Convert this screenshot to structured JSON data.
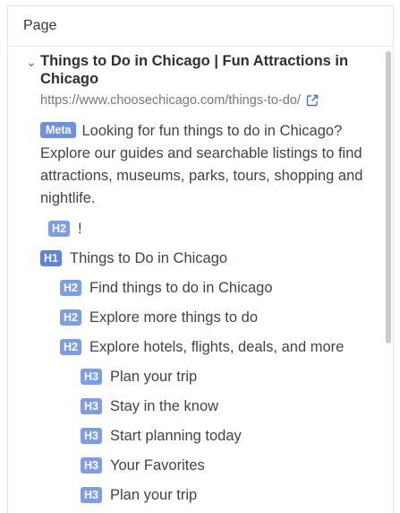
{
  "panel": {
    "header": "Page"
  },
  "page": {
    "title": "Things to Do in Chicago | Fun Attractions in Chicago",
    "url": "https://www.choosechicago.com/things-to-do/",
    "meta_badge": "Meta",
    "meta_description": "Looking for fun things to do in Chicago? Explore our guides and searchable listings to find attractions, museums, parks, tours, shopping and nightlife."
  },
  "headings": [
    {
      "level": "H2",
      "text": "!"
    },
    {
      "level": "H1",
      "text": "Things to Do in Chicago"
    },
    {
      "level": "H2",
      "text": "Find things to do in Chicago"
    },
    {
      "level": "H2",
      "text": "Explore more things to do"
    },
    {
      "level": "H2",
      "text": "Explore hotels, flights, deals, and more"
    },
    {
      "level": "H3",
      "text": "Plan your trip"
    },
    {
      "level": "H3",
      "text": "Stay in the know"
    },
    {
      "level": "H3",
      "text": "Start planning today"
    },
    {
      "level": "H3",
      "text": "Your Favorites"
    },
    {
      "level": "H3",
      "text": "Plan your trip"
    }
  ],
  "icons": {
    "collapse": "chevron-down-icon",
    "external_link": "external-link-icon"
  },
  "colors": {
    "badge": "#7d9de6",
    "accent": "#4a6fd0"
  }
}
